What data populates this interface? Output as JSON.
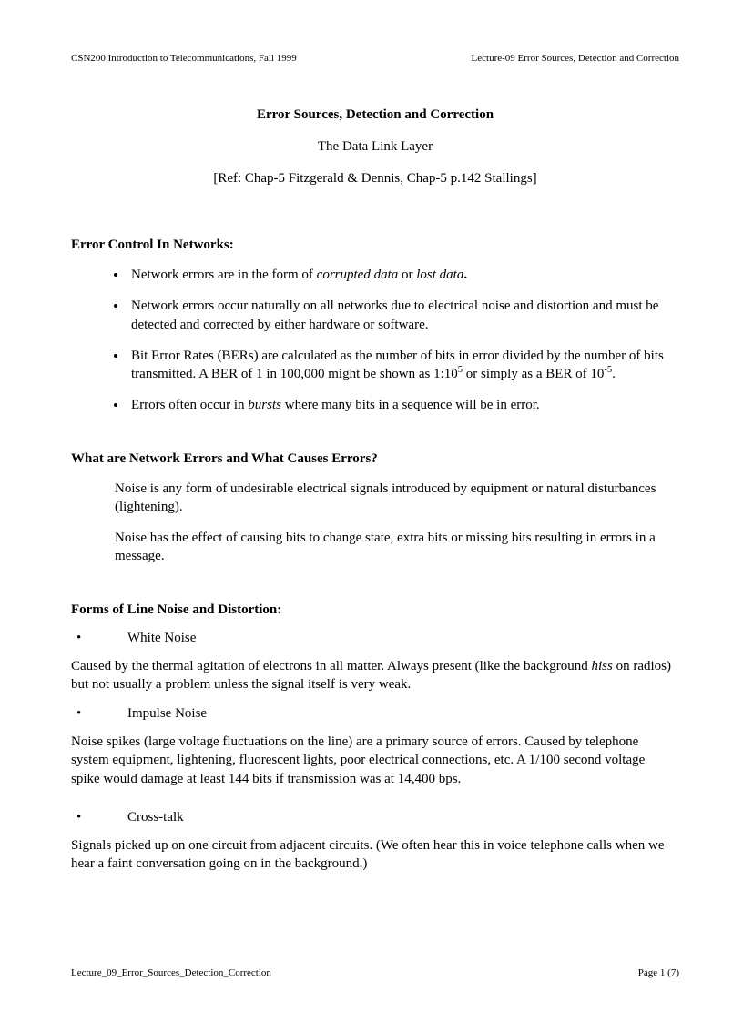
{
  "header": {
    "left": "CSN200 Introduction to Telecommunications,   Fall 1999",
    "right": "Lecture-09  Error Sources, Detection and Correction"
  },
  "title": "Error  Sources, Detection and Correction",
  "subtitle": "The Data Link Layer",
  "ref": "[Ref:   Chap-5 Fitzgerald  & Dennis,  Chap-5 p.142 Stallings]",
  "section1": {
    "heading": "Error  Control In Networks:",
    "bullets": {
      "b1a": "Network errors are in the form of ",
      "b1b": "corrupted data",
      "b1c": " or ",
      "b1d": "lost data",
      "b1e": ".",
      "b2": "Network errors occur naturally  on all networks due to electrical  noise and distortion and must be detected and corrected by either hardware or software.",
      "b3a": "Bit Error Rates (BERs) are calculated  as the number of bits in error divided by the number of bits transmitted.   A BER of 1 in 100,000 might  be shown as 1:10",
      "b3b": "5",
      "b3c": " or simply as a BER of 10",
      "b3d": "-5",
      "b3e": ".",
      "b4a": "Errors often occur in ",
      "b4b": "bursts",
      "b4c": " where many bits in a sequence will  be in error."
    }
  },
  "section2": {
    "heading": "What are Network Errors  and What Causes Errors?",
    "p1": "Noise is any form of undesirable  electrical  signals introduced by equipment  or natural disturbances  (lightening).",
    "p2": "Noise has the effect of causing  bits to change state, extra bits or missing  bits resulting  in errors in a message."
  },
  "section3": {
    "heading": "Forms of Line Noise and Distortion:",
    "item1": "White Noise",
    "p1a": "Caused by the thermal  agitation  of electrons in all matter.  Always present (like the background ",
    "p1b": "hiss",
    "p1c": " on radios) but not usually  a problem unless the signal  itself is very weak.",
    "item2": "Impulse Noise",
    "p2": "Noise spikes (large voltage fluctuations  on the line)  are a primary source of errors. Caused by telephone system equipment, lightening,  fluorescent lights, poor electrical connections, etc. A 1/100 second voltage spike would damage at least 144 bits if transmission  was at 14,400 bps.",
    "item3": "Cross-talk",
    "p3": "Signals picked up on one circuit from adjacent circuits.   (We often hear this in voice telephone calls when we hear a faint  conversation going  on in the background.)"
  },
  "footer": {
    "left": "Lecture_09_Error_Sources_Detection_Correction",
    "right": "Page 1 (7)"
  }
}
